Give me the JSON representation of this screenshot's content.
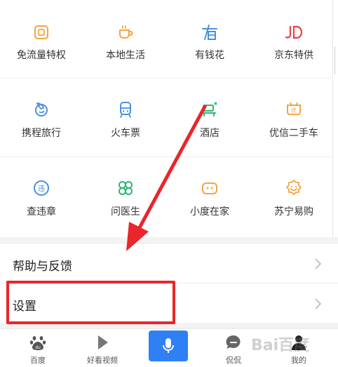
{
  "services": [
    [
      {
        "label": "免流量特权",
        "icon": "free-data-icon",
        "color": "#f5a442"
      },
      {
        "label": "本地生活",
        "icon": "coffee-cup-icon",
        "color": "#f5a442"
      },
      {
        "label": "有钱花",
        "icon": "you-qian-hua-icon",
        "color": "#4a90e2"
      },
      {
        "label": "京东特供",
        "icon": "jd-icon",
        "color": "#e8404a"
      }
    ],
    [
      {
        "label": "携程旅行",
        "icon": "ctrip-icon",
        "color": "#4a90e2"
      },
      {
        "label": "火车票",
        "icon": "train-icon",
        "color": "#4a90e2"
      },
      {
        "label": "酒店",
        "icon": "hotel-bed-icon",
        "color": "#2bb673"
      },
      {
        "label": "优信二手车",
        "icon": "youxin-car-icon",
        "color": "#f5a442"
      }
    ],
    [
      {
        "label": "查违章",
        "icon": "traffic-violation-icon",
        "color": "#4a90e2"
      },
      {
        "label": "问医生",
        "icon": "clover-doctor-icon",
        "color": "#2bb673"
      },
      {
        "label": "小度在家",
        "icon": "xiaodu-home-icon",
        "color": "#f5a442"
      },
      {
        "label": "苏宁易购",
        "icon": "suning-icon",
        "color": "#f5a442"
      }
    ]
  ],
  "menu": {
    "help_label": "帮助与反馈",
    "settings_label": "设置"
  },
  "tabbar": {
    "tabs": [
      {
        "label": "百度",
        "icon": "baidu-paw-icon"
      },
      {
        "label": "好看视频",
        "icon": "play-icon"
      },
      {
        "label": "侃侃",
        "icon": "chat-bubble-icon"
      },
      {
        "label": "我的",
        "icon": "profile-icon"
      }
    ],
    "voice_icon": "microphone-icon"
  },
  "watermark": "Bai百度",
  "colors": {
    "accent_blue": "#2f7ff5",
    "highlight_red": "#e8262b"
  }
}
